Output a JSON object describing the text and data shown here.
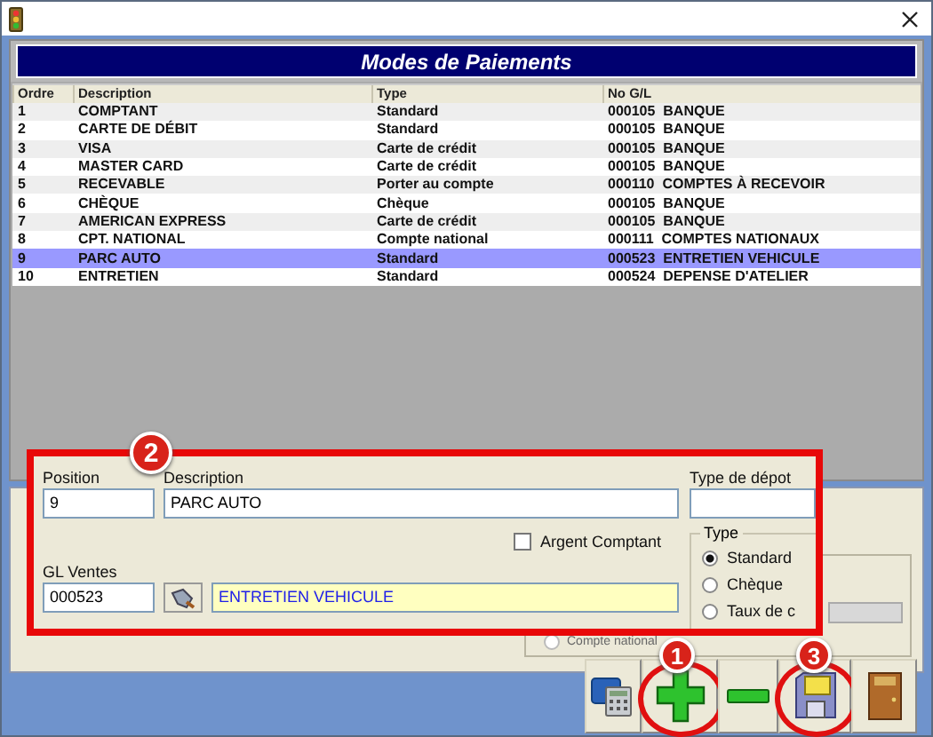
{
  "header": {
    "title": "Modes de Paiements"
  },
  "table": {
    "columns": [
      "Ordre",
      "Description",
      "Type",
      "No G/L"
    ],
    "rows": [
      {
        "cells": [
          "1",
          "COMPTANT",
          "Standard",
          "000105  BANQUE"
        ],
        "selected": false
      },
      {
        "cells": [
          "2",
          "CARTE DE DÉBIT",
          "Standard",
          "000105  BANQUE"
        ],
        "selected": false
      },
      {
        "cells": [
          "3",
          "VISA",
          "Carte de crédit",
          "000105  BANQUE"
        ],
        "selected": false
      },
      {
        "cells": [
          "4",
          "MASTER CARD",
          "Carte de crédit",
          "000105  BANQUE"
        ],
        "selected": false
      },
      {
        "cells": [
          "5",
          "RECEVABLE",
          "Porter au compte",
          "000110  COMPTES À RECEVOIR"
        ],
        "selected": false
      },
      {
        "cells": [
          "6",
          "CHÈQUE",
          "Chèque",
          "000105  BANQUE"
        ],
        "selected": false
      },
      {
        "cells": [
          "7",
          "AMERICAN EXPRESS",
          "Carte de crédit",
          "000105  BANQUE"
        ],
        "selected": false
      },
      {
        "cells": [
          "8",
          "CPT. NATIONAL",
          "Compte national",
          "000111  COMPTES NATIONAUX"
        ],
        "selected": false
      },
      {
        "cells": [
          "9",
          "PARC AUTO",
          "Standard",
          "000523  ENTRETIEN VEHICULE"
        ],
        "selected": true
      },
      {
        "cells": [
          "10",
          "ENTRETIEN",
          "Standard",
          "000524  DEPENSE D'ATELIER"
        ],
        "selected": false
      }
    ]
  },
  "background_panel": {
    "option": {
      "label": "Compte national",
      "selected": false
    }
  },
  "detail_form": {
    "callout": "2",
    "position_label": "Position",
    "position_value": "9",
    "description_label": "Description",
    "description_value": "PARC AUTO",
    "deposit_type_label": "Type de dépot",
    "cash_checkbox": {
      "label": "Argent Comptant",
      "checked": false
    },
    "gl_label": "GL Ventes",
    "gl_value": "000523",
    "gl_description": "ENTRETIEN VEHICULE",
    "type_group": {
      "title": "Type",
      "options": [
        {
          "label": "Standard",
          "selected": true
        },
        {
          "label": "Chèque",
          "selected": false
        },
        {
          "label": "Taux de c",
          "selected": false
        }
      ]
    }
  },
  "toolbar": [
    {
      "kind": "calculator",
      "highlighted": false
    },
    {
      "kind": "add",
      "highlighted": true,
      "callout": "1"
    },
    {
      "kind": "remove",
      "highlighted": false
    },
    {
      "kind": "save",
      "highlighted": true,
      "callout": "3"
    },
    {
      "kind": "exit",
      "highlighted": false
    }
  ]
}
